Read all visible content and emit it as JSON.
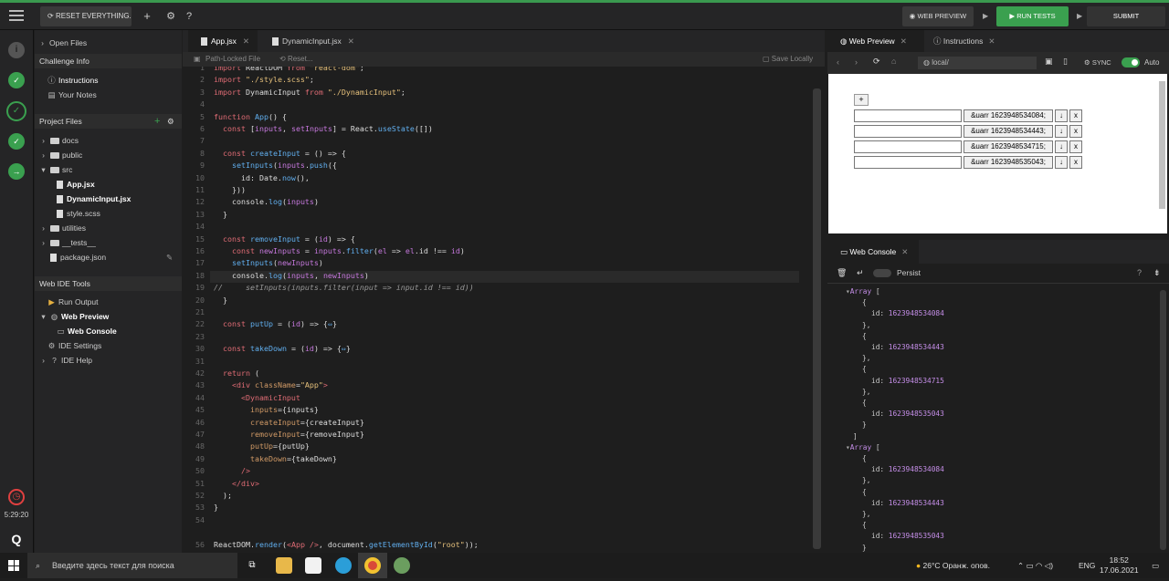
{
  "topbar": {
    "reset_label": "RESET EVERYTHING...",
    "webpreview_label": "WEB PREVIEW",
    "run_label": "RUN TESTS",
    "submit_label": "SUBMIT",
    "accent": "#3aa04f"
  },
  "rail": {
    "time": "5:29:20"
  },
  "sidebar": {
    "open_files": "Open Files",
    "challenge_info": "Challenge Info",
    "instructions": "Instructions",
    "your_notes": "Your Notes",
    "project_files": "Project Files",
    "tree": [
      "docs",
      "public",
      "src",
      "App.jsx",
      "DynamicInput.jsx",
      "style.scss",
      "utilities",
      "__tests__",
      "package.json"
    ],
    "tools_head": "Web IDE Tools",
    "run_output": "Run Output",
    "web_preview": "Web Preview",
    "web_console": "Web Console",
    "ide_settings": "IDE Settings",
    "ide_help": "IDE Help"
  },
  "editor": {
    "tabs": [
      "App.jsx",
      "DynamicInput.jsx"
    ],
    "path_locked": "Path-Locked File",
    "reset": "Reset...",
    "save_locally": "Save Locally",
    "line_numbers": [
      "1",
      "2",
      "3",
      "4",
      "5",
      "6",
      "7",
      "8",
      "9",
      "10",
      "11",
      "12",
      "13",
      "14",
      "15",
      "16",
      "17",
      "18",
      "19",
      "20",
      "21",
      "22",
      "23",
      "30",
      "31",
      "42",
      "43",
      "44",
      "45",
      "46",
      "47",
      "48",
      "49",
      "50",
      "51",
      "52",
      "53",
      "54",
      "55",
      "56"
    ]
  },
  "right": {
    "tab_preview": "Web Preview",
    "tab_instructions": "Instructions",
    "url": "local/",
    "sync": "SYNC",
    "auto": "Auto",
    "add_btn": "+",
    "rows": [
      "&uarr 1623948534084;",
      "&uarr 1623948534443;",
      "&uarr 1623948534715;",
      "&uarr 1623948535043;"
    ],
    "down_btn": "↓",
    "x_btn": "x",
    "console_tab": "Web Console",
    "persist": "Persist"
  },
  "console": {
    "array_label": "Array [",
    "arr1": [
      "1623948534084",
      "1623948534443",
      "1623948534715",
      "1623948535043"
    ],
    "arr2": [
      "1623948534084",
      "1623948534443",
      "1623948535043"
    ]
  },
  "taskbar": {
    "search_placeholder": "Введите здесь текст для поиска",
    "weather": "26°C  Оранж. опов.",
    "lang": "ENG",
    "time": "18:52",
    "date": "17.06.2021"
  }
}
